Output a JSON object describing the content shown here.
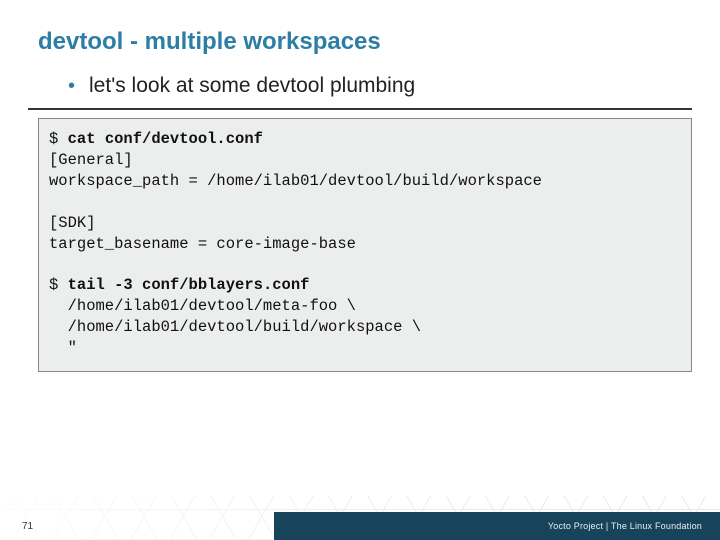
{
  "title": "devtool - multiple workspaces",
  "bullet": "let's look at some devtool plumbing",
  "code": {
    "l1a": "$ ",
    "l1b": "cat conf/devtool.conf",
    "l2": "[General]",
    "l3": "workspace_path = /home/ilab01/devtool/build/workspace",
    "blank1": "",
    "l4": "[SDK]",
    "l5": "target_basename = core-image-base",
    "blank2": "",
    "l6a": "$ ",
    "l6b": "tail -3 conf/bblayers.conf",
    "l7": "  /home/ilab01/devtool/meta-foo \\",
    "l8": "  /home/ilab01/devtool/build/workspace \\",
    "l9": "  \""
  },
  "footer": {
    "page": "71",
    "credit": "Yocto Project | The Linux Foundation"
  }
}
